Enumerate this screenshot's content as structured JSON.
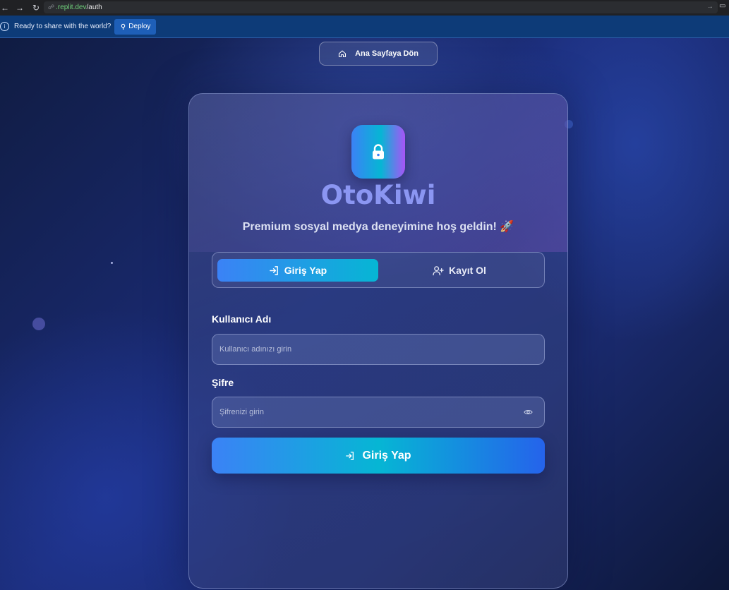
{
  "browser": {
    "url_host": ".replit.dev",
    "url_path": "/auth"
  },
  "deploy_bar": {
    "message": "Ready to share with the world?",
    "deploy_label": "Deploy"
  },
  "header": {
    "home_label": "Ana Sayfaya Dön"
  },
  "auth": {
    "brand": "OtoKiwi",
    "tagline": "Premium sosyal medya deneyimine hoş geldin! 🚀",
    "tabs": [
      {
        "label": "Giriş Yap",
        "active": true
      },
      {
        "label": "Kayıt Ol",
        "active": false
      }
    ],
    "username_label": "Kullanıcı Adı",
    "username_placeholder": "Kullanıcı adınızı girin",
    "password_label": "Şifre",
    "password_placeholder": "Şifrenizi girin",
    "submit_label": "Giriş Yap"
  },
  "colors": {
    "accent_start": "#3b82f6",
    "accent_mid": "#06b6d4",
    "accent_purple": "#a855f7",
    "brand_text": "#8b96f2"
  },
  "icons": [
    "back-arrow-icon",
    "forward-arrow-icon",
    "reload-icon",
    "link-icon",
    "info-icon",
    "deploy-icon",
    "home-icon",
    "lock-icon",
    "login-icon",
    "user-plus-icon",
    "eye-icon"
  ]
}
